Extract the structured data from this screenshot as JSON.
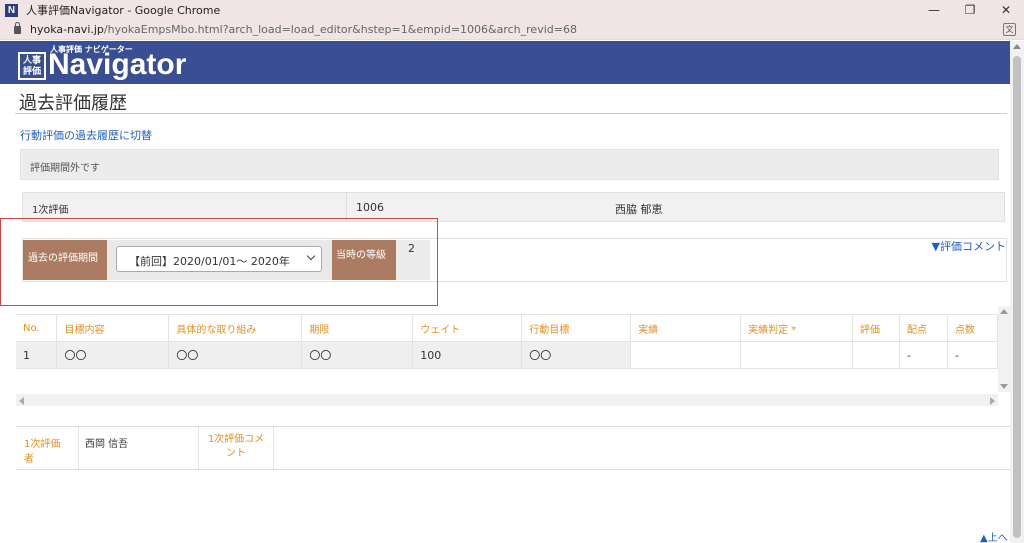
{
  "window": {
    "app_icon_letter": "N",
    "title": "人事評価Navigator - Google Chrome",
    "minimize": "—",
    "restore": "❐",
    "close": "✕"
  },
  "address": {
    "domain": "hyoka-navi.jp",
    "path": "/hyokaEmpsMbo.html?arch_load=load_editor&hstep=1&empid=1006&arch_revid=68"
  },
  "logo": {
    "mark_text": "人事評価",
    "sub_text": "人事評価 ナビゲーター",
    "text": "Navigator"
  },
  "page": {
    "title": "過去評価履歴",
    "switch_link": "行動評価の過去履歴に切替",
    "info_message": "評価期間外です"
  },
  "eval_row": {
    "stage": "1次評価",
    "emp_id": "1006",
    "emp_name": "西脇 郁恵"
  },
  "period": {
    "label": "過去の評価期間",
    "selected": "【前回】2020/01/01～ 2020年",
    "grade_label": "当時の等級",
    "grade_value": "2",
    "comment_toggle": "▼評価コメント"
  },
  "table": {
    "headers": [
      "No.",
      "目標内容",
      "具体的な取り組み",
      "期限",
      "ウェイト",
      "行動目標",
      "実績",
      "実績判定 *",
      "評価",
      "配点",
      "点数"
    ],
    "rows": [
      [
        "1",
        "〇〇",
        "〇〇",
        "〇〇",
        "100",
        "〇〇",
        "",
        "",
        "",
        "-",
        "-"
      ]
    ]
  },
  "evaluator": {
    "label": "1次評価者",
    "name": "西岡 信吾",
    "comment_label": "1次評価コメント"
  },
  "footer": {
    "to_top": "▲上へ"
  }
}
